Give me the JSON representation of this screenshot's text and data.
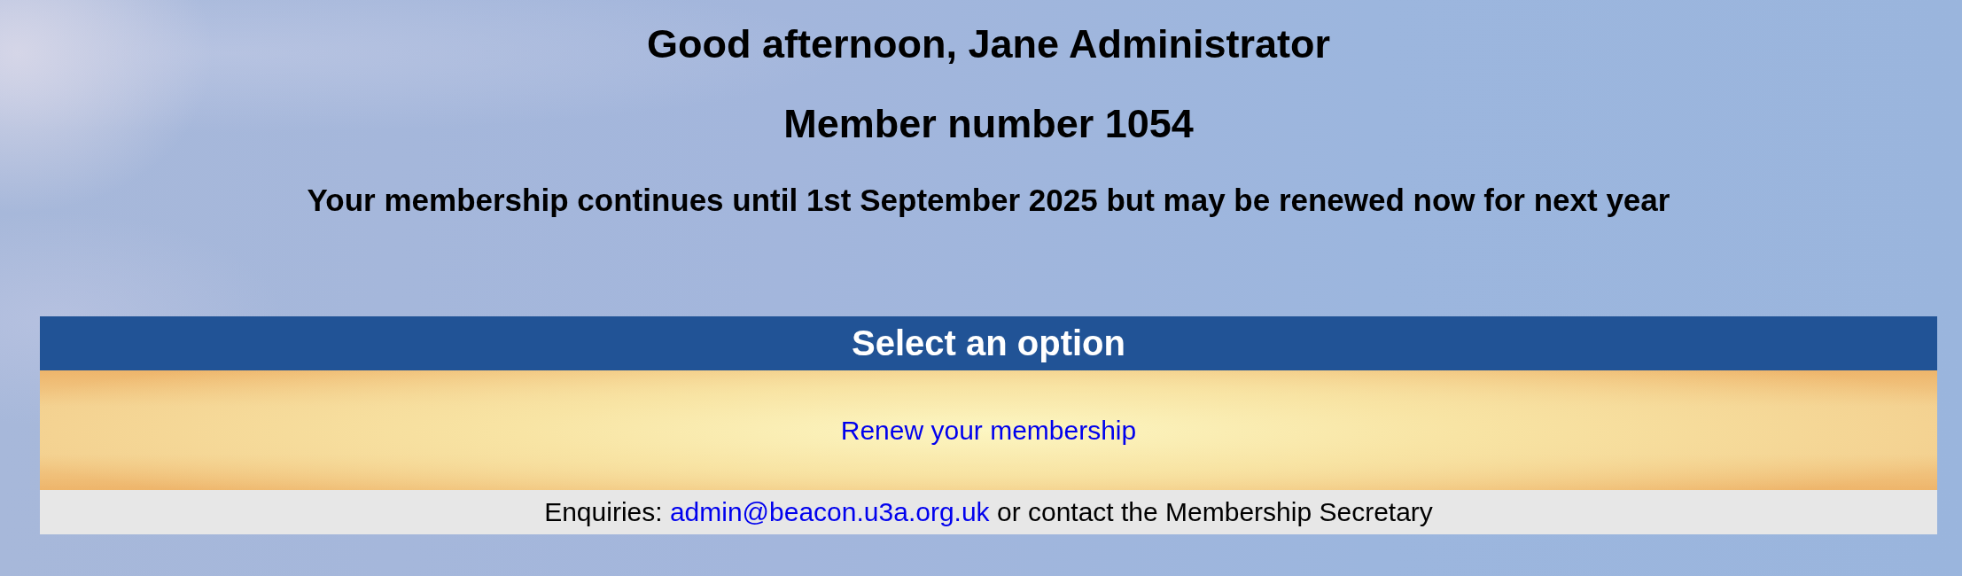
{
  "greeting": "Good afternoon, Jane Administrator",
  "member_number": "Member number 1054",
  "membership_status": "Your membership continues until 1st September 2025 but may be renewed now for next year",
  "options_panel": {
    "title": "Select an option",
    "options": [
      {
        "label": "Renew your membership"
      }
    ]
  },
  "footer": {
    "prefix": "Enquiries:",
    "email": "admin@beacon.u3a.org.uk",
    "suffix": "or contact the Membership Secretary"
  }
}
